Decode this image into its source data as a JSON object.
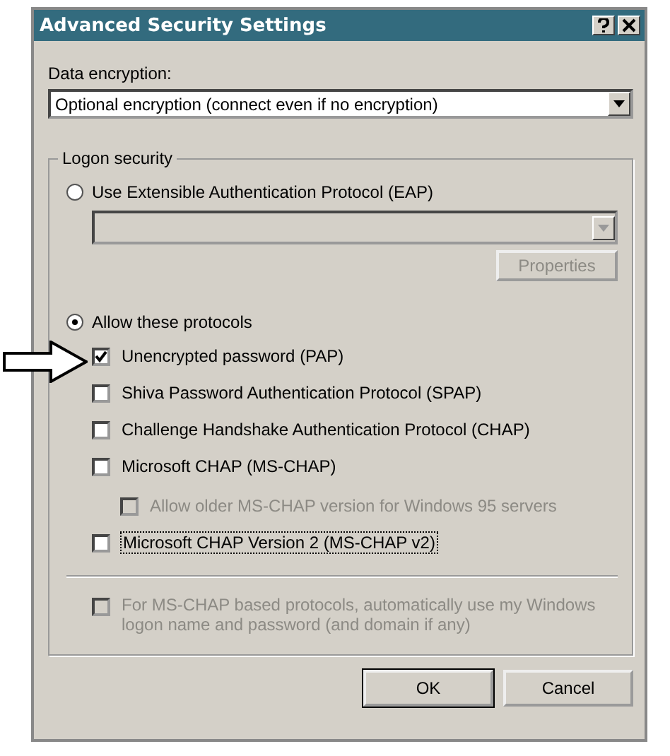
{
  "window": {
    "title": "Advanced Security Settings"
  },
  "data_encryption": {
    "label": "Data encryption:",
    "value": "Optional encryption (connect even if no encryption)"
  },
  "logon_security": {
    "title": "Logon security",
    "options": [
      {
        "label": "Use Extensible Authentication Protocol (EAP)",
        "selected": false
      },
      {
        "label": "Allow these protocols",
        "selected": true
      }
    ],
    "eap_field": {
      "disabled": true
    },
    "properties_button": {
      "label": "Properties",
      "disabled": true
    },
    "protocols": [
      {
        "label": "Unencrypted password (PAP)",
        "checked": true,
        "disabled": false,
        "focused": false
      },
      {
        "label": "Shiva Password Authentication Protocol (SPAP)",
        "checked": false,
        "disabled": false,
        "focused": false
      },
      {
        "label": "Challenge Handshake Authentication Protocol (CHAP)",
        "checked": false,
        "disabled": false,
        "focused": false
      },
      {
        "label": "Microsoft CHAP (MS-CHAP)",
        "checked": false,
        "disabled": false,
        "focused": false,
        "children": [
          {
            "label": "Allow older MS-CHAP version for Windows 95 servers",
            "checked": false,
            "disabled": true,
            "focused": false
          }
        ]
      },
      {
        "label": "Microsoft CHAP Version 2 (MS-CHAP v2)",
        "checked": false,
        "disabled": false,
        "focused": true
      }
    ],
    "auto_logon": {
      "label": "For MS-CHAP based protocols, automatically use my Windows logon name and password (and domain if any)",
      "checked": false,
      "disabled": true
    }
  },
  "buttons": [
    {
      "label": "OK",
      "default": true
    },
    {
      "label": "Cancel",
      "default": false
    }
  ]
}
